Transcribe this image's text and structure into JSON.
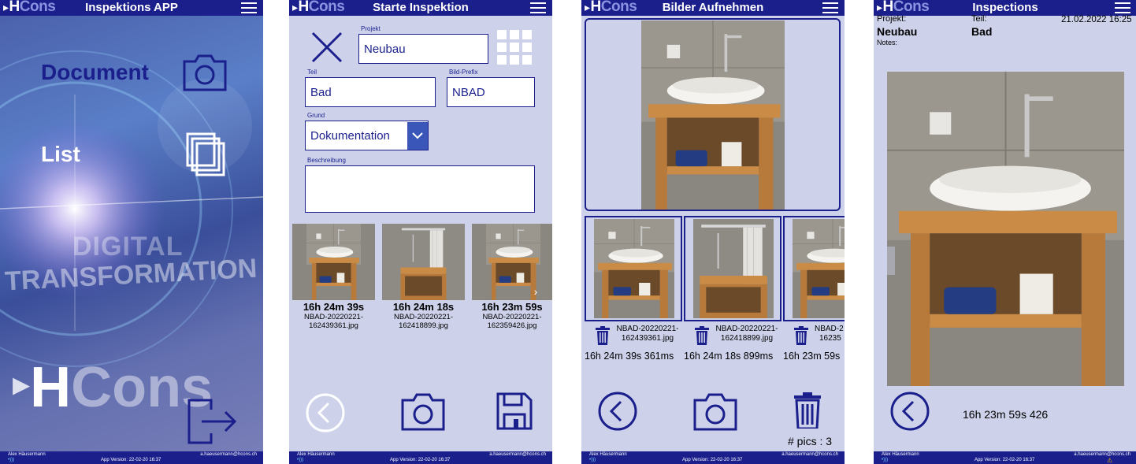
{
  "common": {
    "logo_arrow": "▸",
    "logo_h": "H",
    "logo_cons": "Cons",
    "footer_user": "Alex Häusermann",
    "footer_wifi": "•)))",
    "footer_version": "App Version:   22-02-20 16:37",
    "footer_email": "a.haeusermann@hcons.ch"
  },
  "screen1": {
    "title": "Inspektions APP",
    "document_label": "Document",
    "list_label": "List",
    "bg_word1": "DIGITAL",
    "bg_word2": "TRANSFORMATION",
    "bg_logo_h": "H",
    "bg_logo_cons": "Cons"
  },
  "screen2": {
    "title": "Starte Inspektion",
    "projekt_label": "Projekt",
    "projekt_value": "Neubau",
    "teil_label": "Teil",
    "teil_value": "Bad",
    "prefix_label": "Bild-Prefix",
    "prefix_value": "NBAD",
    "grund_label": "Grund",
    "grund_value": "Dokumentation",
    "beschreibung_label": "Beschreibung",
    "beschreibung_value": "",
    "thumbs": [
      {
        "time": "16h 24m 39s",
        "file1": "NBAD-20220221-",
        "file2": "162439361.jpg"
      },
      {
        "time": "16h 24m 18s",
        "file1": "NBAD-20220221-",
        "file2": "162418899.jpg"
      },
      {
        "time": "16h 23m 59s",
        "file1": "NBAD-20220221-",
        "file2": "162359426.jpg"
      }
    ],
    "scroll_arrow": "›"
  },
  "screen3": {
    "title": "Bilder Aufnehmen",
    "thumbs": [
      {
        "file1": "NBAD-20220221-",
        "file2": "162439361.jpg",
        "time": "16h 24m 39s 361ms"
      },
      {
        "file1": "NBAD-20220221-",
        "file2": "162418899.jpg",
        "time": "16h 24m 18s 899ms"
      },
      {
        "file1": "NBAD-2",
        "file2": "16235",
        "time": "16h 23m 59s"
      }
    ],
    "pics_count": "# pics : 3"
  },
  "screen4": {
    "title": "Inspections",
    "projekt_label": "Projekt:",
    "projekt_value": "Neubau",
    "teil_label": "Teil:",
    "teil_value": "Bad",
    "date": "21.02.2022 16:25",
    "notes_label": "Notes:",
    "timestamp": "16h 23m 59s 426",
    "warn_icon": "⚠"
  },
  "colors": {
    "navy": "#1a1f8c",
    "panel": "#cdd2ea",
    "logo_accent": "#8c93e0"
  }
}
